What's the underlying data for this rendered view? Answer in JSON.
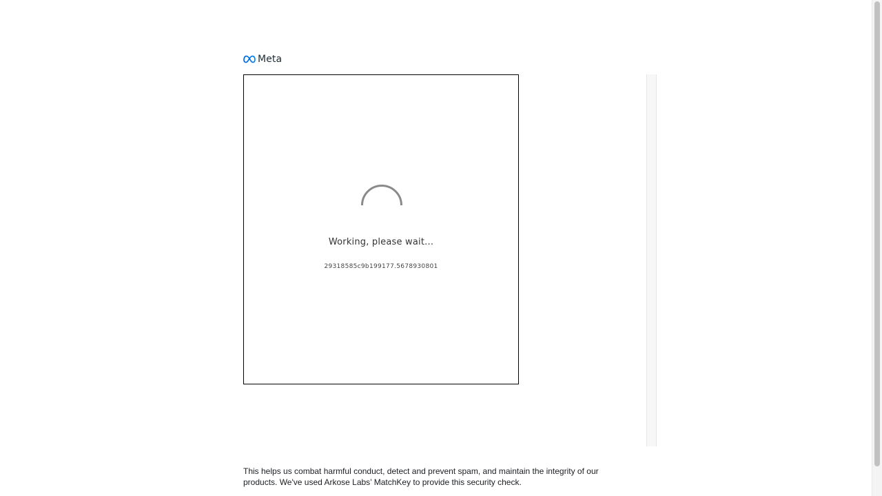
{
  "header": {
    "logo_text": "Meta",
    "logo_icon": "meta-infinity-icon",
    "brand_color": "#0668E1"
  },
  "challenge": {
    "status_text": "Working, please wait...",
    "session_id": "29318585c9b199177.5678930801",
    "spinner_icon": "loading-spinner-icon"
  },
  "footer": {
    "text": "This helps us combat harmful conduct, detect and prevent spam, and maintain the integrity of our products. We've used Arkose Labs’ MatchKey to provide this security check."
  }
}
